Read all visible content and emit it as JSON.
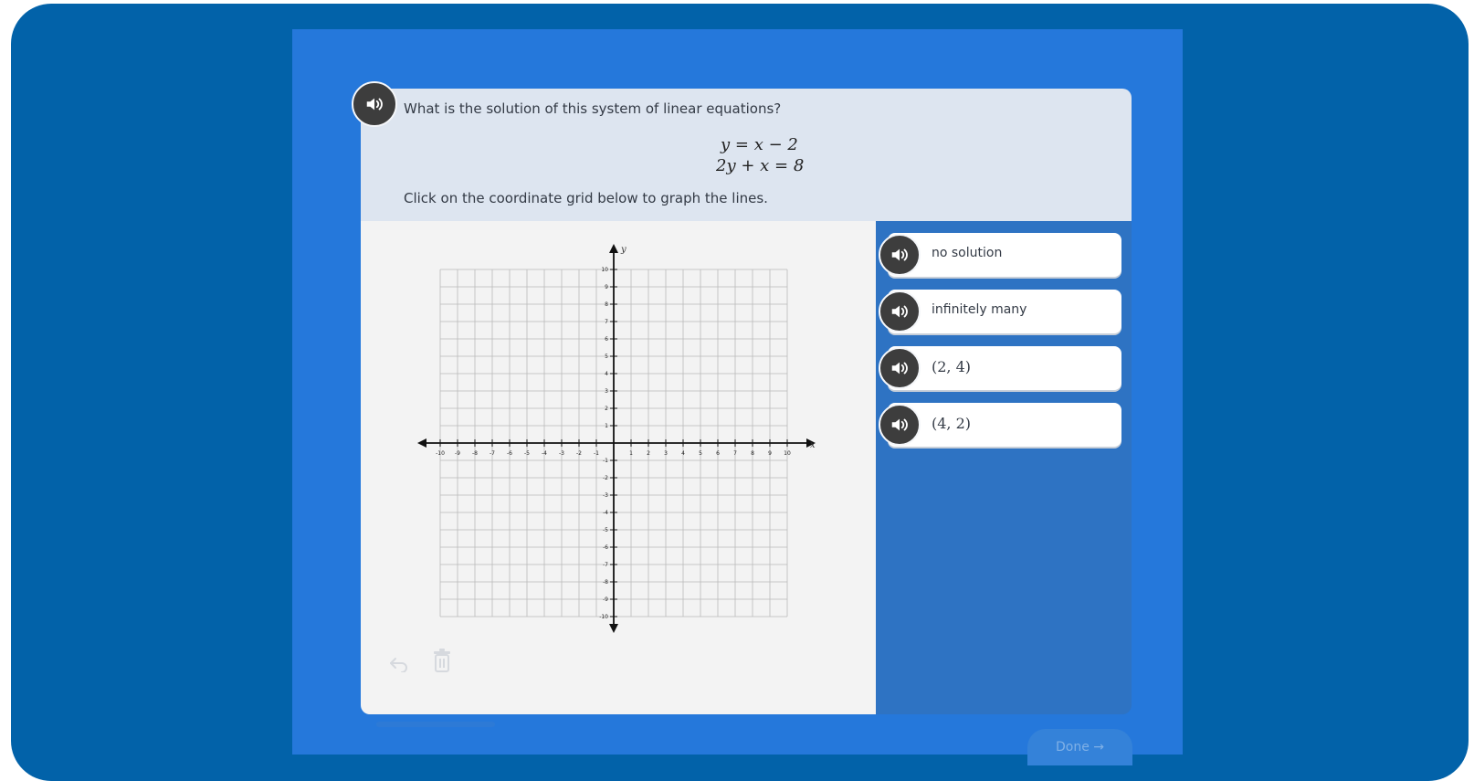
{
  "question": {
    "prompt": "What is the solution of this system of linear equations?",
    "equations": [
      "y = x − 2",
      "2y + x = 8"
    ],
    "instruction": "Click on the coordinate grid below to graph the lines."
  },
  "graph": {
    "x_axis_label": "x",
    "y_axis_label": "y",
    "range": [
      -10,
      10
    ],
    "tick_labels": [
      "-10",
      "-9",
      "-8",
      "-7",
      "-6",
      "-5",
      "-4",
      "-3",
      "-2",
      "-1",
      "1",
      "2",
      "3",
      "4",
      "5",
      "6",
      "7",
      "8",
      "9",
      "10"
    ]
  },
  "choices": [
    {
      "label": "no solution",
      "math": false
    },
    {
      "label": "infinitely many",
      "math": false
    },
    {
      "label": "(2, 4)",
      "math": true
    },
    {
      "label": "(4, 2)",
      "math": true
    }
  ],
  "icons": {
    "speaker": "speaker-icon",
    "undo": "undo-icon",
    "trash": "trash-icon"
  },
  "done_button": "Done →",
  "colors": {
    "frame": "#0262a9",
    "panel": "#2578db",
    "question_bg": "#dde5f0",
    "graph_bg": "#f3f3f3",
    "choices_bg": "#2e73c3",
    "speaker_bg": "#3d3d3d"
  }
}
